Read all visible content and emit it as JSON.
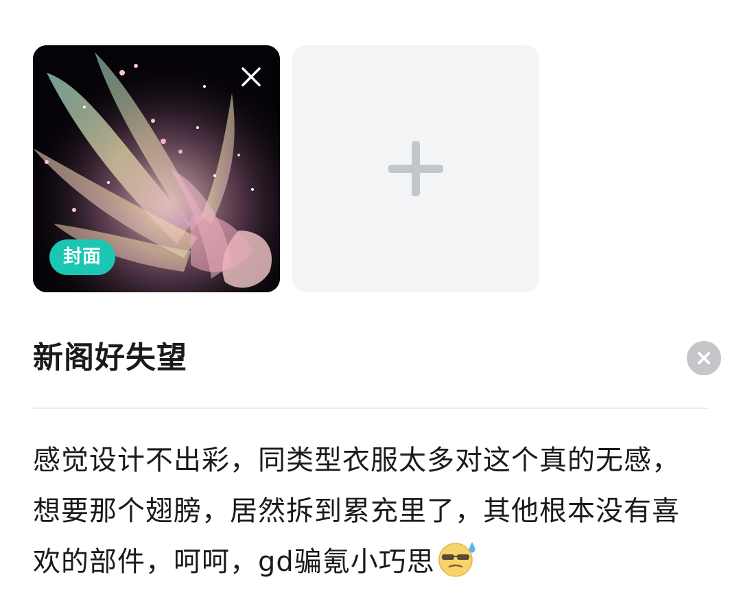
{
  "images": {
    "cover_badge": "封面",
    "thumbnail_subject": "fairy-with-iridescent-wings",
    "icons": {
      "remove": "close-icon",
      "add": "plus-icon"
    }
  },
  "title": {
    "text": "新阁好失望",
    "clear_icon": "clear-circle-icon"
  },
  "body": {
    "text": "感觉设计不出彩，同类型衣服太多对这个真的无感，想要那个翅膀，居然拆到累充里了，其他根本没有喜欢的部件，呵呵，gd骗氪小巧思",
    "emoji": "sweat-sunglasses-emoji"
  },
  "colors": {
    "cover_badge": "#19c7b3",
    "add_tile_bg": "#f3f4f6",
    "plus": "#c2c5ca",
    "clear_button": "#c4c6ca",
    "text": "#1a1a1a",
    "divider": "#ececec"
  }
}
